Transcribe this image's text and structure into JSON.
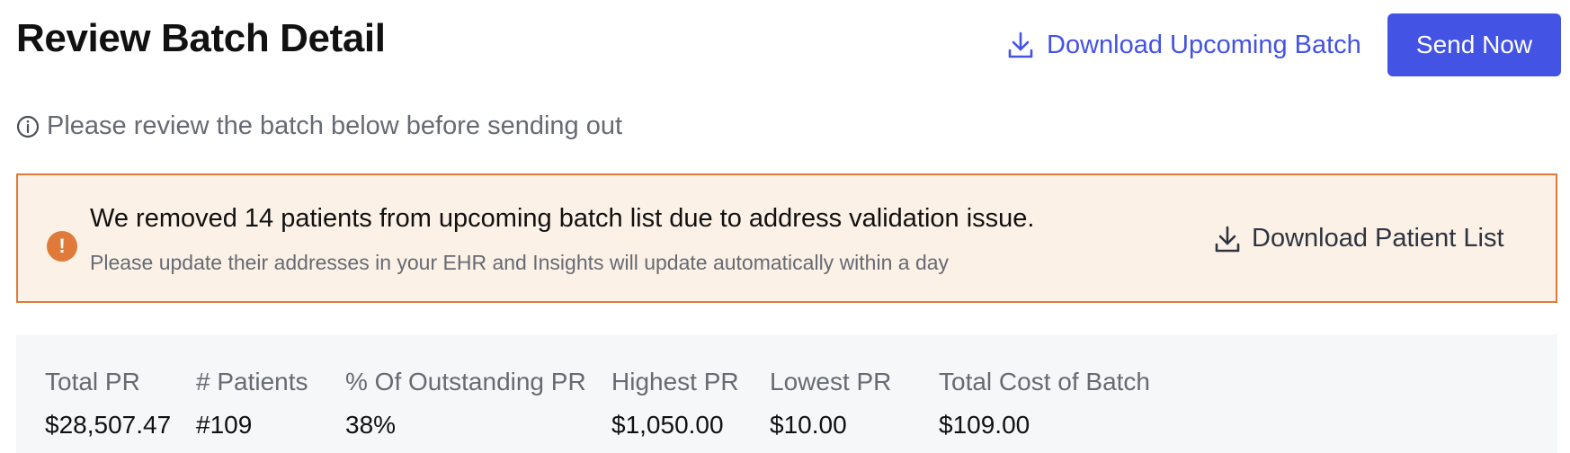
{
  "header": {
    "title": "Review Batch Detail",
    "download_batch_label": "Download Upcoming Batch",
    "send_now_label": "Send Now"
  },
  "info": {
    "text": "Please review the batch below before sending out"
  },
  "alert": {
    "title": "We removed 14 patients from upcoming batch list due to address validation issue.",
    "subtitle": "Please update their addresses in your EHR and Insights will update automatically within a day",
    "download_label": "Download Patient List",
    "icon_glyph": "!"
  },
  "stats": [
    {
      "label": "Total PR",
      "value": "$28,507.47"
    },
    {
      "label": "# Patients",
      "value": "#109"
    },
    {
      "label": "% Of Outstanding PR",
      "value": "38%"
    },
    {
      "label": "Highest PR",
      "value": "$1,050.00"
    },
    {
      "label": "Lowest PR",
      "value": "$10.00"
    },
    {
      "label": "Total Cost of Batch",
      "value": "$109.00"
    }
  ],
  "colors": {
    "accent": "#4353e3",
    "alert_border": "#e07a3a",
    "alert_background": "#fcf1e6",
    "stats_background": "#f6f7f9"
  },
  "icons": {
    "download": "download-icon",
    "info": "info-icon",
    "alert": "alert-icon"
  }
}
